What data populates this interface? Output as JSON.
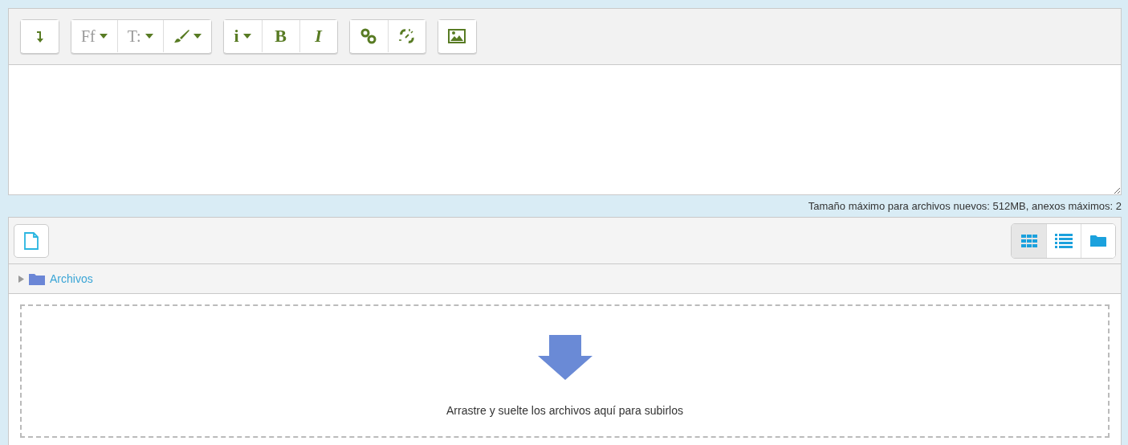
{
  "editor": {
    "toolbar_groups": [
      {
        "buttons": [
          {
            "kind": "arrow"
          }
        ]
      },
      {
        "buttons": [
          {
            "kind": "text-dropdown",
            "label": "Ff"
          },
          {
            "kind": "text-dropdown",
            "label": "T:"
          },
          {
            "kind": "brush-dropdown"
          }
        ]
      },
      {
        "buttons": [
          {
            "kind": "bold-dropdown",
            "label": "i"
          },
          {
            "kind": "bold",
            "label": "B"
          },
          {
            "kind": "italic",
            "label": "I"
          }
        ]
      },
      {
        "buttons": [
          {
            "kind": "link"
          },
          {
            "kind": "unlink"
          }
        ]
      },
      {
        "buttons": [
          {
            "kind": "image"
          }
        ]
      }
    ]
  },
  "limits_note": "Tamaño máximo para archivos nuevos: 512MB, anexos máximos: 2",
  "file_manager": {
    "view_buttons": [
      {
        "kind": "grid",
        "selected": true
      },
      {
        "kind": "list",
        "selected": false
      },
      {
        "kind": "tree",
        "selected": false
      }
    ],
    "path": "Archivos",
    "drop_hint": "Arrastre y suelte los archivos aquí para subirlos"
  }
}
